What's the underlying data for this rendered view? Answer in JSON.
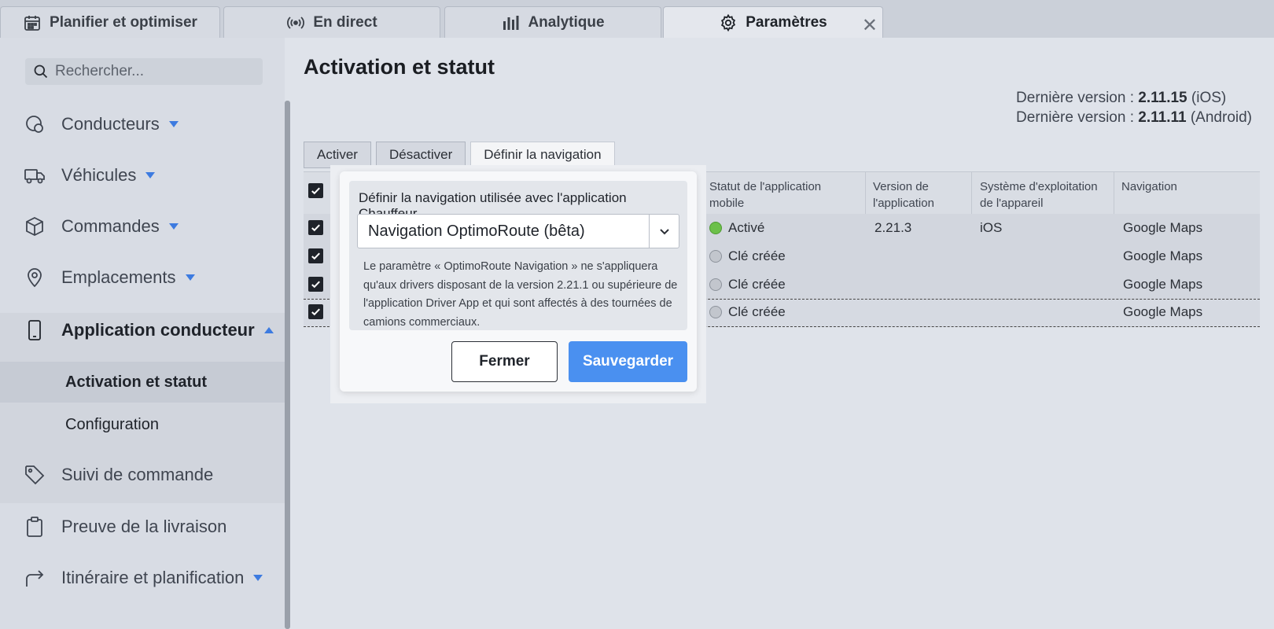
{
  "tabs": [
    {
      "label": "Planifier et optimiser",
      "icon": "calendar-icon"
    },
    {
      "label": "En direct",
      "icon": "broadcast-icon"
    },
    {
      "label": "Analytique",
      "icon": "bar-chart-icon"
    },
    {
      "label": "Paramètres",
      "icon": "gear-icon",
      "active": true
    }
  ],
  "sidebar": {
    "search_placeholder": "Rechercher...",
    "items": [
      {
        "label": "Conducteurs",
        "icon": "driver-icon",
        "has_dropdown": true
      },
      {
        "label": "Véhicules",
        "icon": "truck-icon",
        "has_dropdown": true
      },
      {
        "label": "Commandes",
        "icon": "box-icon",
        "has_dropdown": true
      },
      {
        "label": "Emplacements",
        "icon": "location-pin-icon",
        "has_dropdown": true
      },
      {
        "label": "Application conducteur",
        "icon": "phone-icon",
        "expanded": true
      },
      {
        "label": "Suivi de commande",
        "icon": "tag-icon"
      },
      {
        "label": "Preuve de la livraison",
        "icon": "clipboard-icon"
      },
      {
        "label": "Itinéraire et planification",
        "icon": "route-arrow-icon",
        "has_dropdown": true
      }
    ],
    "sub_items": [
      {
        "label": "Activation et statut",
        "selected": true
      },
      {
        "label": "Configuration"
      }
    ]
  },
  "main": {
    "title": "Activation et statut",
    "version_ios_prefix": "Dernière version : ",
    "version_ios": "2.11.15",
    "version_ios_suffix": " (iOS)",
    "version_android_prefix": "Dernière version : ",
    "version_android": "2.11.11",
    "version_android_suffix": " (Android)",
    "toolbar": {
      "activate": "Activer",
      "deactivate": "Désactiver",
      "set_navigation": "Définir la navigation"
    },
    "table": {
      "headers": {
        "status": "Statut de l'application mobile",
        "app_version": "Version de l'application",
        "os": "Système d'exploitation de l'appareil",
        "navigation": "Navigation"
      },
      "rows": [
        {
          "status": "Activé",
          "status_color": "#6cc04a",
          "version": "2.21.3",
          "os": "iOS",
          "navigation": "Google Maps",
          "truncated": ""
        },
        {
          "status": "Clé créée",
          "status_color": "#c2c6cd",
          "version": "",
          "os": "",
          "navigation": "Google Maps",
          "truncated": "…"
        },
        {
          "status": "Clé créée",
          "status_color": "#c2c6cd",
          "version": "",
          "os": "",
          "navigation": "Google Maps",
          "truncated": "…"
        },
        {
          "status": "Clé créée",
          "status_color": "#c2c6cd",
          "version": "",
          "os": "",
          "navigation": "Google Maps",
          "truncated": "…"
        }
      ]
    }
  },
  "popover": {
    "label": "Définir la navigation utilisée avec l'application Chauffeur",
    "selected_option": "Navigation OptimoRoute (bêta)",
    "help_text": "Le paramètre « OptimoRoute Navigation » ne s'appliquera qu'aux drivers disposant de la version 2.21.1 ou supérieure de l'application Driver App et qui sont affectés à des tournées de camions commerciaux.",
    "close_label": "Fermer",
    "save_label": "Sauvegarder"
  },
  "colors": {
    "accent": "#4a90f0",
    "caret": "#3d7be0",
    "active_status": "#6cc04a"
  }
}
